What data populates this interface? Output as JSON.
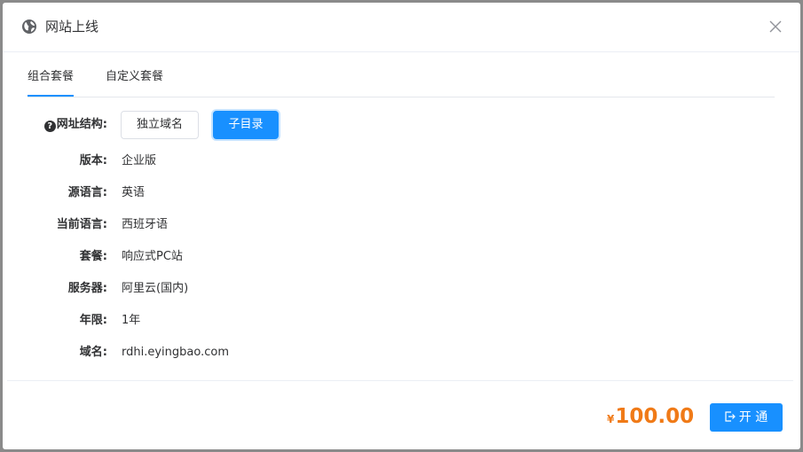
{
  "dialog": {
    "title": "网站上线",
    "icon": "globe-icon",
    "close_icon": "close-icon"
  },
  "tabs": [
    {
      "label": "组合套餐",
      "active": true
    },
    {
      "label": "自定义套餐",
      "active": false
    }
  ],
  "form": {
    "url_structure": {
      "label": "网址结构:",
      "options": [
        "独立域名",
        "子目录"
      ],
      "selected": "子目录"
    },
    "rows": [
      {
        "label": "版本:",
        "value": "企业版"
      },
      {
        "label": "源语言:",
        "value": "英语"
      },
      {
        "label": "当前语言:",
        "value": "西班牙语"
      },
      {
        "label": "套餐:",
        "value": "响应式PC站"
      },
      {
        "label": "服务器:",
        "value": "阿里云(国内)"
      },
      {
        "label": "年限:",
        "value": "1年"
      },
      {
        "label": "域名:",
        "value": "rdhi.eyingbao.com"
      }
    ]
  },
  "footer": {
    "currency": "¥",
    "price": "100.00",
    "open_button": "开 通"
  },
  "colors": {
    "accent": "#1890ff",
    "price": "#f07a17"
  }
}
